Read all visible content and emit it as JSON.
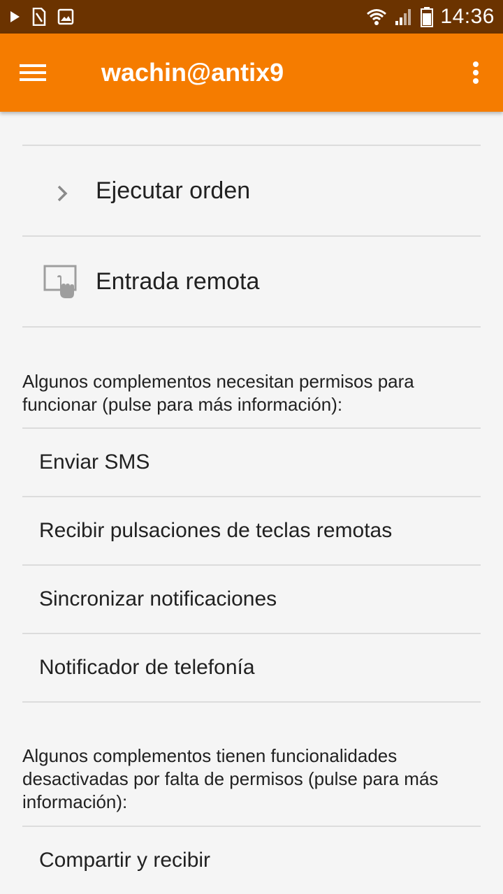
{
  "status_bar": {
    "time": "14:36",
    "icons": [
      "play-icon",
      "sim-card-icon",
      "image-icon",
      "wifi-icon",
      "signal-icon",
      "battery-icon"
    ]
  },
  "app_bar": {
    "title": "wachin@antix9",
    "background": "#f57c00",
    "menu_icon": "hamburger-menu-icon",
    "overflow_icon": "more-vert-icon"
  },
  "plugins": [
    {
      "label": "Ejecutar orden",
      "icon": "chevron-right-icon"
    },
    {
      "label": "Entrada remota",
      "icon": "touchpad-icon"
    }
  ],
  "permissions_needed": {
    "note": "Algunos complementos necesitan permisos para funcionar (pulse para más información):",
    "items": [
      {
        "label": "Enviar SMS"
      },
      {
        "label": "Recibir pulsaciones de teclas remotas"
      },
      {
        "label": "Sincronizar notificaciones"
      },
      {
        "label": "Notificador de telefonía"
      }
    ]
  },
  "features_disabled": {
    "note": "Algunos complementos tienen funcionalidades desactivadas por falta de permisos (pulse para más información):",
    "items": [
      {
        "label": "Compartir y recibir"
      }
    ]
  }
}
